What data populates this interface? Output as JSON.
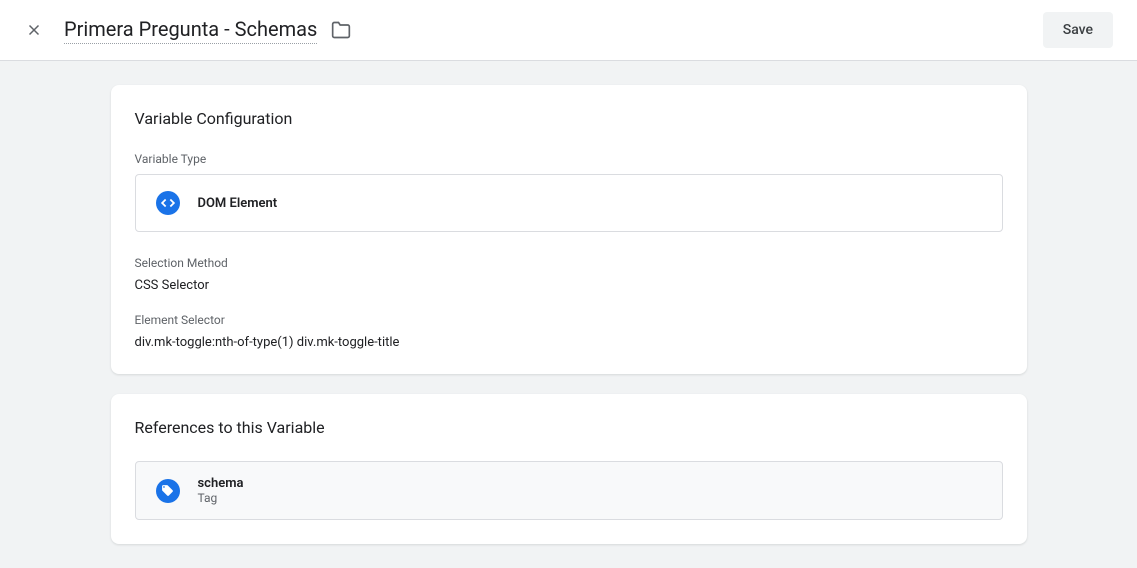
{
  "header": {
    "title": "Primera Pregunta - Schemas",
    "save_label": "Save"
  },
  "config_card": {
    "title": "Variable Configuration",
    "type_label": "Variable Type",
    "type_name": "DOM Element",
    "selection_method_label": "Selection Method",
    "selection_method_value": "CSS Selector",
    "element_selector_label": "Element Selector",
    "element_selector_value": "div.mk-toggle:nth-of-type(1) div.mk-toggle-title"
  },
  "references_card": {
    "title": "References to this Variable",
    "items": [
      {
        "name": "schema",
        "type": "Tag"
      }
    ]
  }
}
